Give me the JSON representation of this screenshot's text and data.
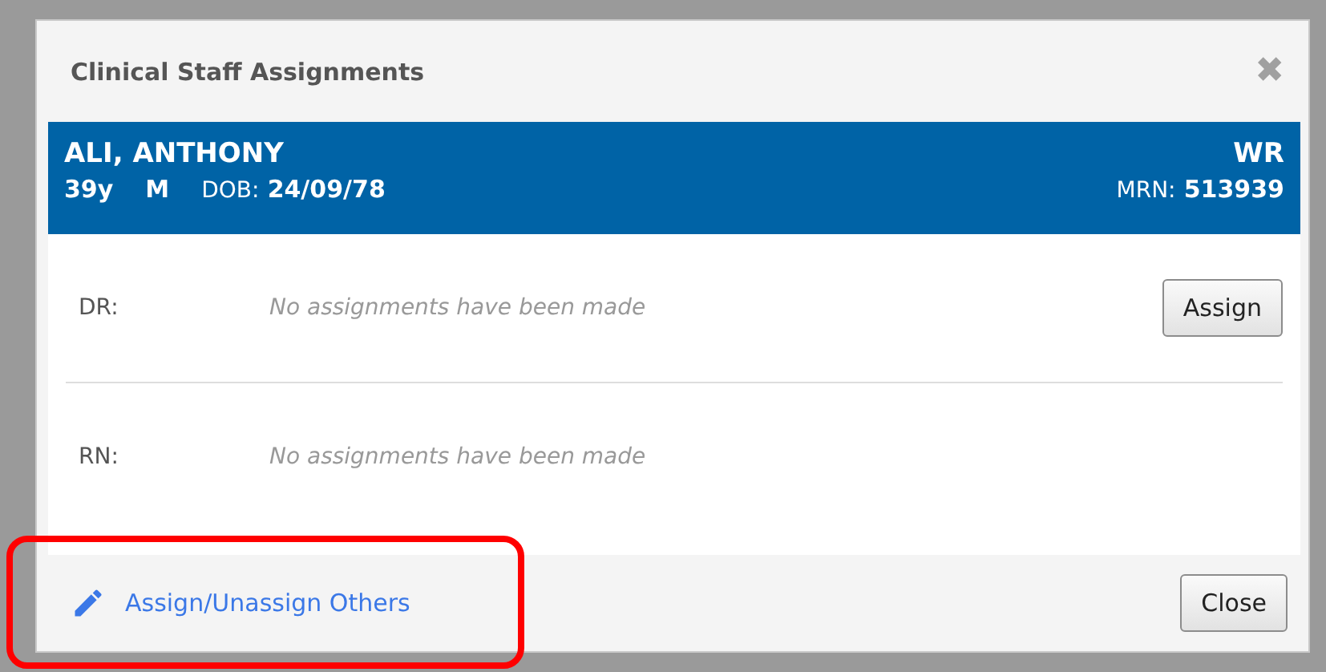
{
  "dialog": {
    "title": "Clinical Staff Assignments",
    "close_icon": "✖"
  },
  "patient": {
    "name": "ALI, ANTHONY",
    "location": "WR",
    "age": "39y",
    "sex": "M",
    "dob_label": "DOB:",
    "dob": "24/09/78",
    "mrn_label": "MRN:",
    "mrn": "513939"
  },
  "assignments": [
    {
      "role": "DR:",
      "message": "No assignments have been made",
      "has_assign_button": true,
      "button": "Assign"
    },
    {
      "role": "RN:",
      "message": "No assignments have been made",
      "has_assign_button": false
    }
  ],
  "footer": {
    "link": "Assign/Unassign Others",
    "highlighted": true,
    "close_button": "Close"
  }
}
